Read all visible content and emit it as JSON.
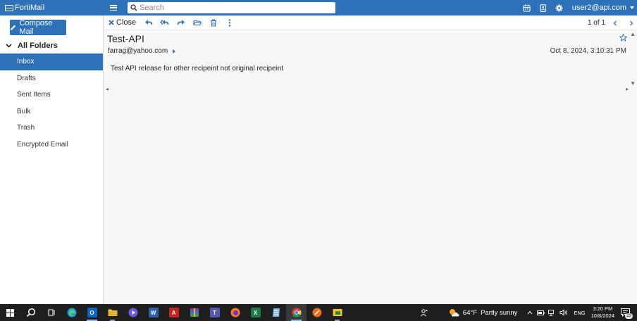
{
  "app": {
    "title": "FortiMail"
  },
  "header": {
    "search_placeholder": "Search",
    "user": "user2@api.com"
  },
  "sidebar": {
    "compose_label": "Compose Mail",
    "folders_label": "All Folders",
    "items": [
      {
        "label": "Inbox",
        "active": true
      },
      {
        "label": "Drafts"
      },
      {
        "label": "Sent Items"
      },
      {
        "label": "Bulk"
      },
      {
        "label": "Trash"
      },
      {
        "label": "Encrypted Email"
      }
    ]
  },
  "toolbar": {
    "close_label": "Close",
    "pager": "1 of 1"
  },
  "message": {
    "subject": "Test-API",
    "sender": "farrag@yahoo.com",
    "date": "Oct 8, 2024, 3:10:31 PM",
    "body": "Test API release for other recipeint not original recipeint"
  },
  "taskbar": {
    "weather_temp": "64°F",
    "weather_desc": "Partly sunny",
    "lang": "ENG",
    "time": "3:20 PM",
    "date": "10/8/2024",
    "notification_count": "23"
  },
  "colors": {
    "accent": "#2d72b8",
    "taskbar": "#1f1f1f"
  }
}
